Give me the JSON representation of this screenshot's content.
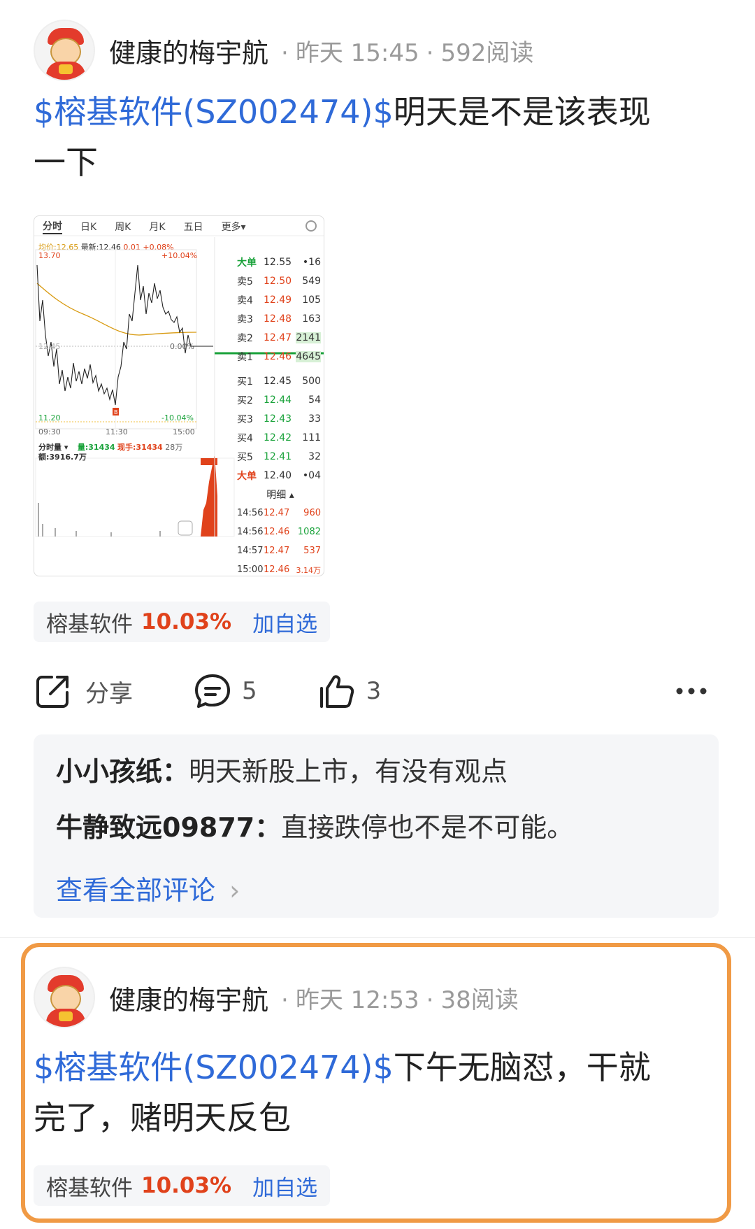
{
  "post1": {
    "author": "健康的梅宇航",
    "time": "昨天 15:45",
    "reads": "592阅读",
    "stock_link": "$榕基软件(SZ002474)$",
    "text_line1": "明天是不是该表现",
    "text_line2": "一下",
    "chart": {
      "tabs": [
        "分时",
        "日K",
        "周K",
        "月K",
        "五日",
        "更多▾"
      ],
      "avg_label": "均价:12.65",
      "latest_label": "最新:12.46",
      "chg": "0.01",
      "chg_pct": "+0.08%",
      "top_price": "13.70",
      "top_pct": "+10.04%",
      "bottom_price": "11.20",
      "bottom_pct": "-10.04%",
      "mid_pct": "0.00%",
      "mid_price": "12.45",
      "times": [
        "09:30",
        "11:30",
        "15:00"
      ],
      "vol_label": "分时量 ▾",
      "vol_amount": "量:31434",
      "vol_hand": "现手:31434",
      "vol_right": "28万",
      "amount": "额:3916.7万",
      "orderbook": {
        "big_sell": {
          "label": "大单",
          "price": "12.55",
          "vol": "•16"
        },
        "asks": [
          {
            "label": "卖5",
            "price": "12.50",
            "vol": "549"
          },
          {
            "label": "卖4",
            "price": "12.49",
            "vol": "105"
          },
          {
            "label": "卖3",
            "price": "12.48",
            "vol": "163"
          },
          {
            "label": "卖2",
            "price": "12.47",
            "vol": "2141"
          },
          {
            "label": "卖1",
            "price": "12.46",
            "vol": "4645"
          }
        ],
        "bids": [
          {
            "label": "买1",
            "price": "12.45",
            "vol": "500"
          },
          {
            "label": "买2",
            "price": "12.44",
            "vol": "54"
          },
          {
            "label": "买3",
            "price": "12.43",
            "vol": "33"
          },
          {
            "label": "买4",
            "price": "12.42",
            "vol": "111"
          },
          {
            "label": "买5",
            "price": "12.41",
            "vol": "32"
          }
        ],
        "big_buy": {
          "label": "大单",
          "price": "12.40",
          "vol": "•04"
        },
        "detail_title": "明细 ▴",
        "ticks": [
          {
            "time": "14:56",
            "price": "12.47",
            "vol": "960"
          },
          {
            "time": "14:56",
            "price": "12.46",
            "vol": "1082"
          },
          {
            "time": "14:57",
            "price": "12.47",
            "vol": "537"
          },
          {
            "time": "15:00",
            "price": "12.46",
            "vol": "3.14万"
          }
        ]
      }
    },
    "tag": {
      "name": "榕基软件",
      "pct": "10.03%",
      "add": "加自选"
    },
    "actions": {
      "share": "分享",
      "comments": "5",
      "likes": "3"
    },
    "comments": [
      {
        "user": "小小孩纸：",
        "text": "明天新股上市，有没有观点"
      },
      {
        "user": "牛静致远09877：",
        "text": "直接跌停也不是不可能。"
      }
    ],
    "view_all": "查看全部评论",
    "view_all_arrow": "›"
  },
  "post2": {
    "author": "健康的梅宇航",
    "time": "昨天 12:53",
    "reads": "38阅读",
    "stock_link": "$榕基软件(SZ002474)$",
    "text_line1": "下午无脑怼，干就",
    "text_line2": "完了，赌明天反包",
    "tag": {
      "name": "榕基软件",
      "pct": "10.03%",
      "add": "加自选"
    }
  },
  "colors": {
    "link": "#2f6ad8",
    "up": "#e0421b",
    "down": "#19a23a",
    "highlight_border": "#f09a45"
  }
}
